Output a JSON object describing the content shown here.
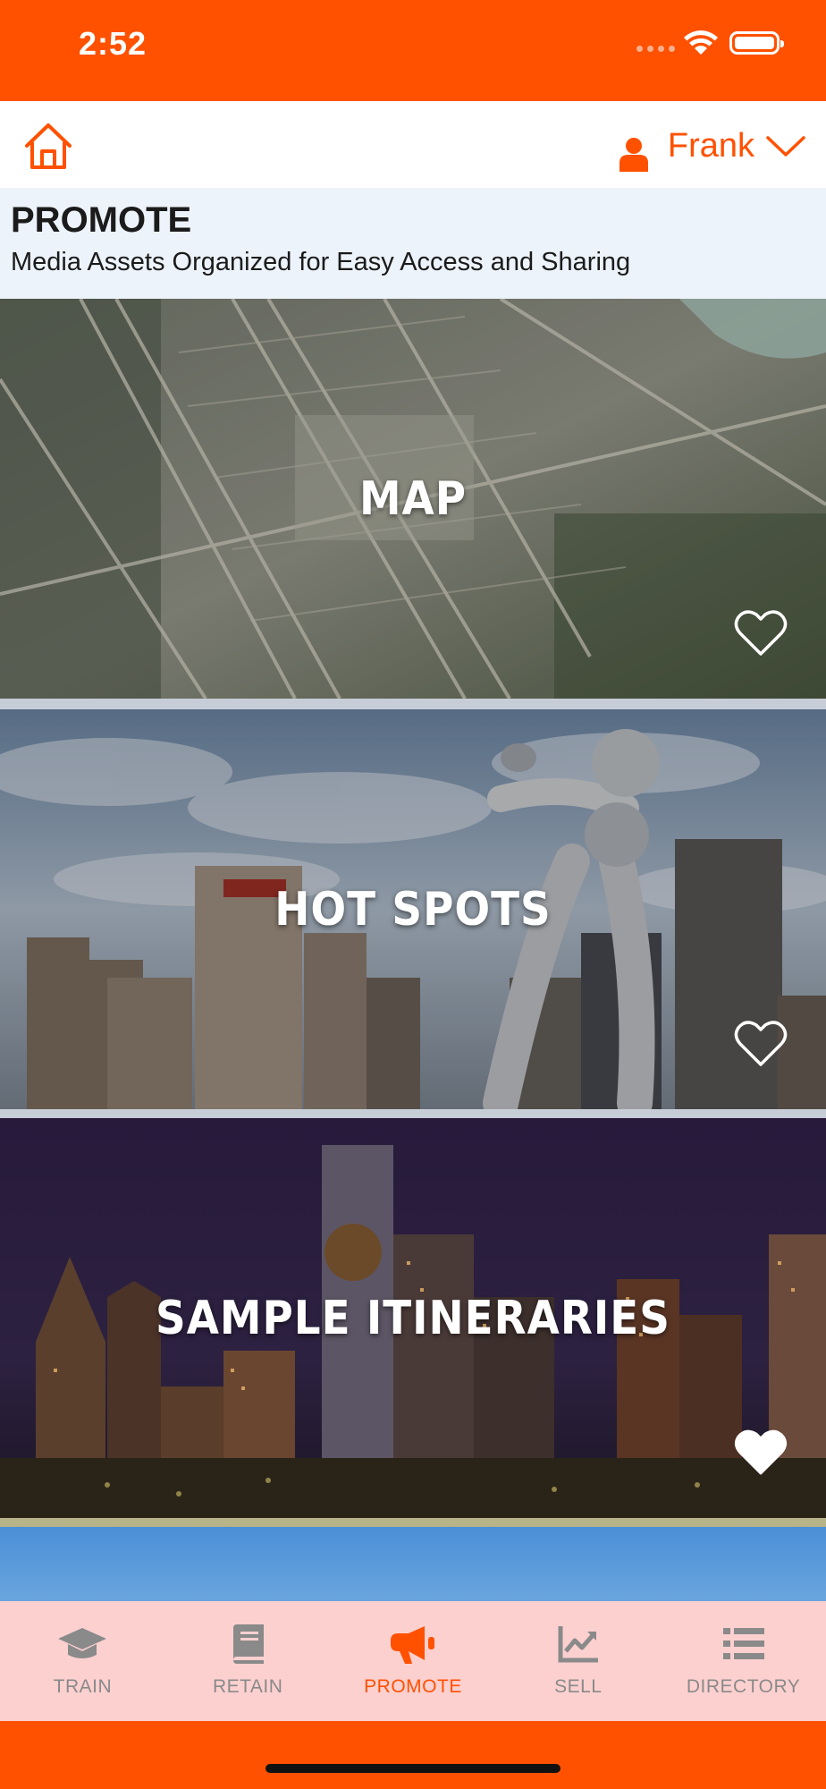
{
  "status_bar": {
    "time": "2:52"
  },
  "header": {
    "user_name": "Frank"
  },
  "page": {
    "title": "PROMOTE",
    "subtitle": "Media Assets Organized for Easy Access and Sharing"
  },
  "cards": [
    {
      "title": "MAP",
      "favorited": false
    },
    {
      "title": "HOT SPOTS",
      "favorited": false
    },
    {
      "title": "SAMPLE ITINERARIES",
      "favorited": true
    }
  ],
  "tabs": [
    {
      "label": "TRAIN",
      "icon": "graduation-cap-icon",
      "active": false
    },
    {
      "label": "RETAIN",
      "icon": "book-icon",
      "active": false
    },
    {
      "label": "PROMOTE",
      "icon": "megaphone-icon",
      "active": true
    },
    {
      "label": "SELL",
      "icon": "chart-line-icon",
      "active": false
    },
    {
      "label": "DIRECTORY",
      "icon": "list-icon",
      "active": false
    }
  ],
  "colors": {
    "brand_orange": "#ff5100",
    "tab_bar_bg": "#fdd0d0",
    "header_bg": "#edf3fa",
    "inactive_tab": "#8a8a8a"
  }
}
